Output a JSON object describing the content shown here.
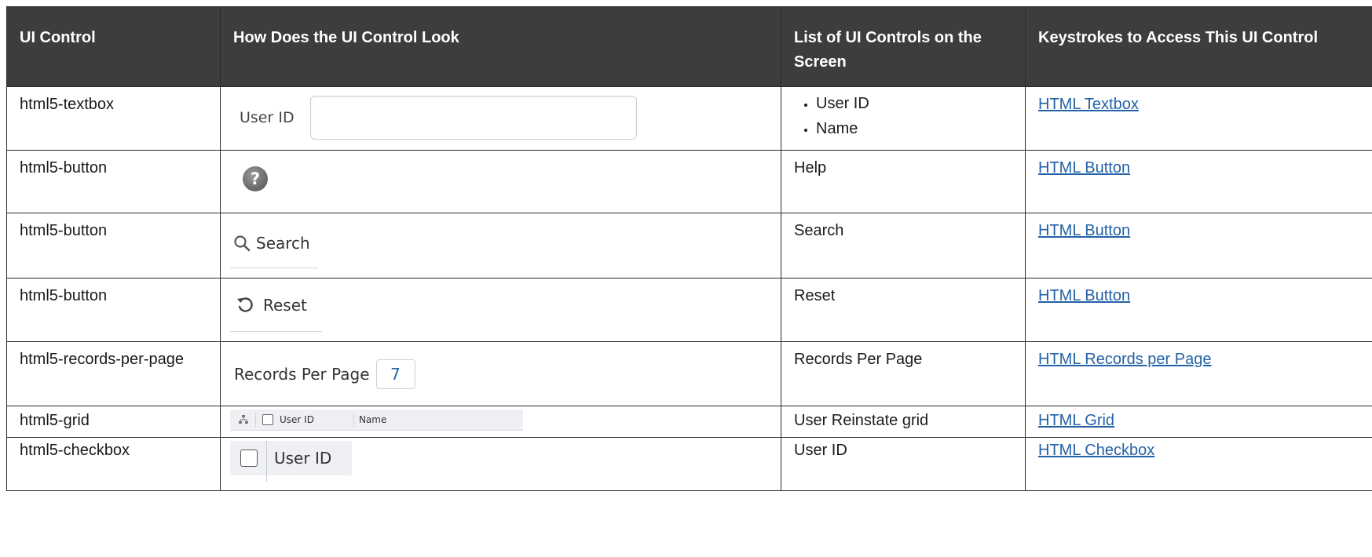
{
  "headers": {
    "ui_control": "UI Control",
    "look": "How Does the UI Control Look",
    "list": "List of UI Controls on the Screen",
    "keys": "Keystrokes to Access This UI Control"
  },
  "rows": [
    {
      "control": "html5-textbox",
      "look": {
        "label": "User ID"
      },
      "list": [
        "User ID",
        "Name"
      ],
      "link": "HTML Textbox"
    },
    {
      "control": "html5-button",
      "look": {
        "icon": "help-icon"
      },
      "list": "Help",
      "link": "HTML Button"
    },
    {
      "control": "html5-button",
      "look": {
        "icon": "search-icon",
        "label": "Search"
      },
      "list": "Search",
      "link": "HTML Button"
    },
    {
      "control": "html5-button",
      "look": {
        "icon": "reset-icon",
        "label": "Reset"
      },
      "list": "Reset",
      "link": "HTML Button"
    },
    {
      "control": "html5-records-per-page",
      "look": {
        "label": "Records Per Page",
        "value": "7"
      },
      "list": "Records Per Page",
      "link": "HTML Records per Page"
    },
    {
      "control": "html5-grid",
      "look": {
        "icon": "hierarchy-icon",
        "col1": "User ID",
        "col2": "Name"
      },
      "list": "User Reinstate grid",
      "link": "HTML Grid"
    },
    {
      "control": "html5-checkbox",
      "look": {
        "label": "User ID"
      },
      "list": "User ID",
      "link": "HTML Checkbox"
    }
  ],
  "colors": {
    "header_bg": "#3d3d3d",
    "link": "#2362a6",
    "value_blue": "#2a64a8"
  }
}
